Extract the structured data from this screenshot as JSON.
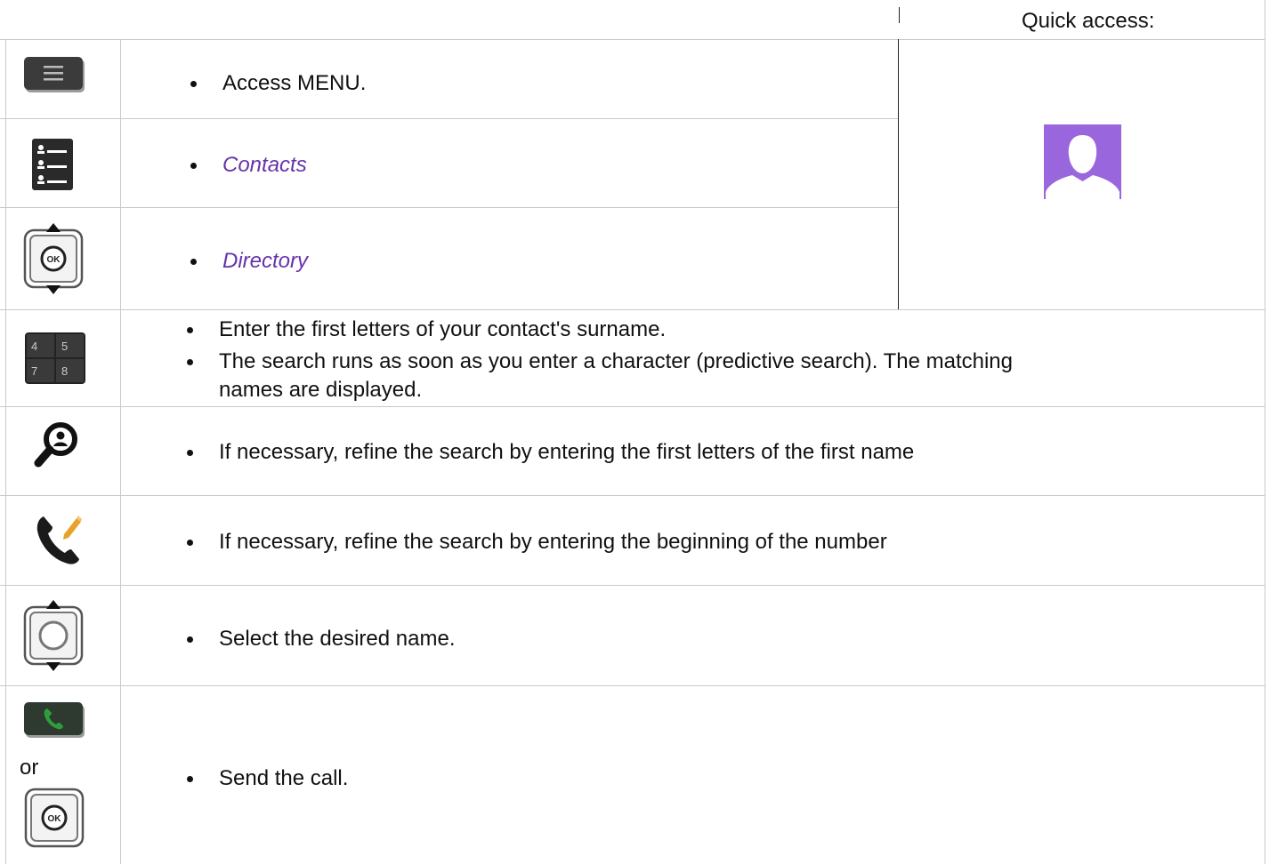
{
  "quick_access": "Quick access:",
  "rows": [
    {
      "text": "Access MENU."
    },
    {
      "text": "Contacts"
    },
    {
      "text": "Directory"
    },
    {
      "lines": [
        "Enter the first letters of your contact's surname.",
        "The search runs as soon as you enter a character (predictive search). The matching",
        "names are displayed."
      ]
    },
    {
      "text": "If necessary, refine the search by entering the first letters of the first name"
    },
    {
      "text": "If necessary, refine the search by entering the beginning of the number"
    },
    {
      "text": "Select the desired name."
    },
    {
      "text": "Send the call.",
      "or": "or"
    }
  ],
  "keypad_digits": [
    "4",
    "5",
    "7",
    "8"
  ],
  "ok_label": "OK",
  "colors": {
    "link_purple": "#6633aa",
    "avatar_purple": "#9966dd",
    "phone_green": "#2e9e3a",
    "pencil_orange": "#e8a22b"
  }
}
